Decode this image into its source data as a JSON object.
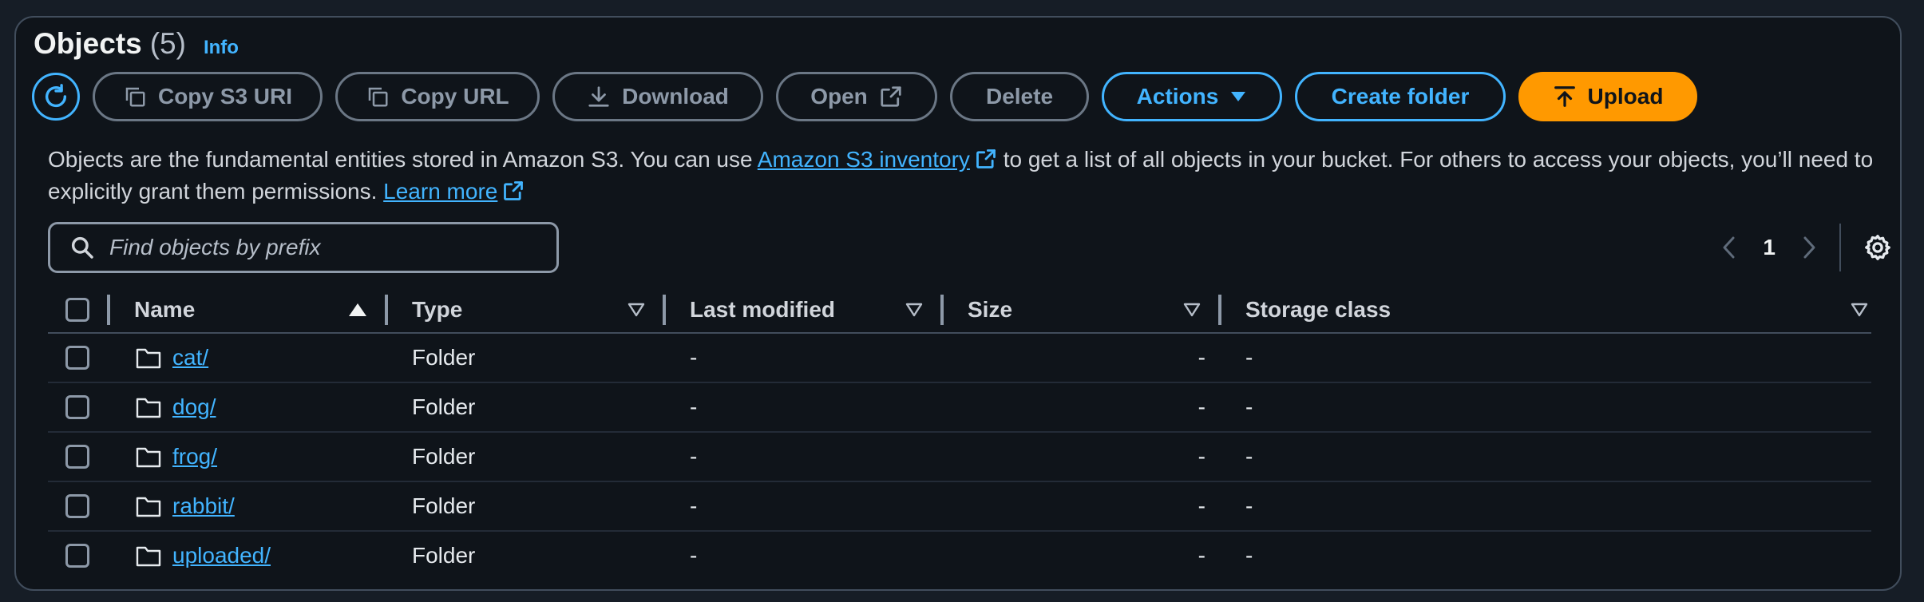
{
  "header": {
    "title": "Objects",
    "count": "(5)",
    "info": "Info"
  },
  "toolbar": {
    "copy_s3_uri": "Copy S3 URI",
    "copy_url": "Copy URL",
    "download": "Download",
    "open": "Open",
    "delete": "Delete",
    "actions": "Actions",
    "create_folder": "Create folder",
    "upload": "Upload"
  },
  "description": {
    "part1": "Objects are the fundamental entities stored in Amazon S3. You can use ",
    "inventory_link": "Amazon S3 inventory",
    "part2": " to get a list of all objects in your bucket. For others to access your objects, you’ll need to explicitly grant them permissions. ",
    "learn_more": "Learn more"
  },
  "search": {
    "placeholder": "Find objects by prefix"
  },
  "pagination": {
    "current_page": "1"
  },
  "table": {
    "columns": [
      "Name",
      "Type",
      "Last modified",
      "Size",
      "Storage class"
    ],
    "rows": [
      {
        "name": "cat/",
        "type": "Folder",
        "last_modified": "-",
        "size": "-",
        "storage_class": "-"
      },
      {
        "name": "dog/",
        "type": "Folder",
        "last_modified": "-",
        "size": "-",
        "storage_class": "-"
      },
      {
        "name": "frog/",
        "type": "Folder",
        "last_modified": "-",
        "size": "-",
        "storage_class": "-"
      },
      {
        "name": "rabbit/",
        "type": "Folder",
        "last_modified": "-",
        "size": "-",
        "storage_class": "-"
      },
      {
        "name": "uploaded/",
        "type": "Folder",
        "last_modified": "-",
        "size": "-",
        "storage_class": "-"
      }
    ]
  },
  "colors": {
    "accent": "#42b4ff",
    "upload_bg": "#ff9900",
    "panel_bg": "#0f141a"
  }
}
